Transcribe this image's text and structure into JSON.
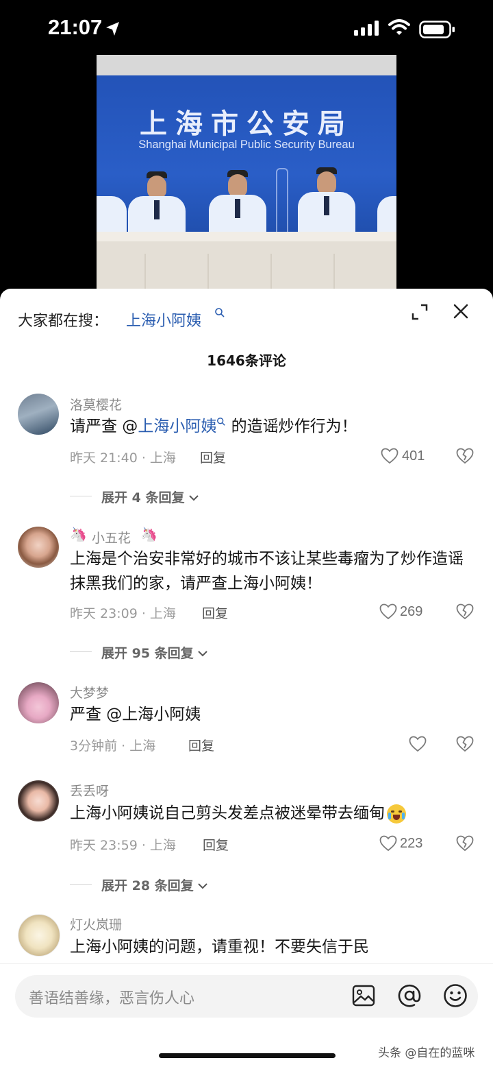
{
  "status_bar": {
    "time": "21:07"
  },
  "video": {
    "title_cn": "上海市公安局",
    "title_en": "Shanghai Municipal Public Security Bureau"
  },
  "header": {
    "search_prefix": "大家都在搜：",
    "search_term": "上海小阿姨",
    "comment_count": "1646条评论"
  },
  "comments": [
    {
      "user": "洛莫樱花",
      "text_before": "请严查 @",
      "mention": "上海小阿姨",
      "text_after": " 的造谣炒作行为！",
      "meta": "昨天 21:40 · 上海",
      "reply": "回复",
      "likes": "401",
      "expand": "展开 4 条回复"
    },
    {
      "user": "小五花",
      "text": "上海是个治安非常好的城市不该让某些毒瘤为了炒作造谣抹黑我们的家，请严查上海小阿姨！",
      "meta": "昨天 23:09 · 上海",
      "reply": "回复",
      "likes": "269",
      "expand": "展开 95 条回复"
    },
    {
      "user": "大梦梦",
      "text": "严查 @上海小阿姨",
      "meta": "3分钟前 · 上海",
      "reply": "回复",
      "likes": ""
    },
    {
      "user": "丢丢呀",
      "text": "上海小阿姨说自己剪头发差点被迷晕带去缅甸",
      "meta": "昨天 23:59 · 上海",
      "reply": "回复",
      "likes": "223",
      "expand": "展开 28 条回复"
    },
    {
      "user": "灯火岚珊",
      "text": "上海小阿姨的问题，请重视！不要失信于民"
    }
  ],
  "input": {
    "placeholder": "善语结善缘，恶言伤人心"
  },
  "watermark": "头条 @自在的蓝咪",
  "colors": {
    "link": "#2a5db0",
    "banner": "#2353b8"
  },
  "icons": [
    "location-arrow-icon",
    "signal-icon",
    "wifi-icon",
    "battery-icon",
    "search-icon",
    "expand-icon",
    "close-icon",
    "heart-icon",
    "broken-heart-icon",
    "chevron-down-icon",
    "image-icon",
    "at-icon",
    "emoji-icon",
    "unicorn-icon",
    "crying-emoji-icon"
  ]
}
